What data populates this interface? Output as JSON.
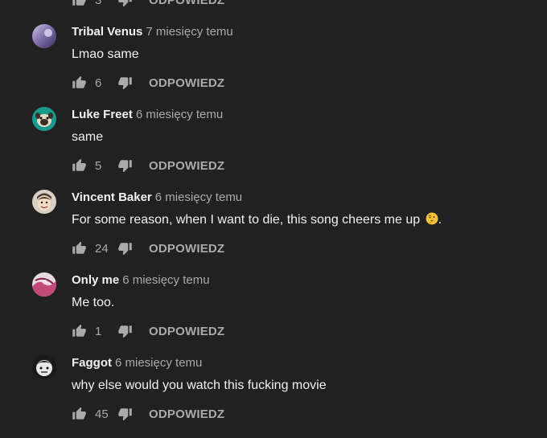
{
  "top_partial": {
    "likes": "3",
    "reply_label": "ODPOWIEDZ"
  },
  "comments": [
    {
      "author": "Tribal Venus",
      "time": "7 miesięcy temu",
      "text": "Lmao same",
      "likes": "6",
      "reply_label": "ODPOWIEDZ",
      "avatar_icon": "purple-gradient-avatar",
      "avatar_color": "#8b7fb0"
    },
    {
      "author": "Luke Freet",
      "time": "6 miesięcy temu",
      "text": "same",
      "likes": "5",
      "reply_label": "ODPOWIEDZ",
      "avatar_icon": "pug-avatar",
      "avatar_color": "#1a9a8a"
    },
    {
      "author": "Vincent Baker",
      "time": "6 miesięcy temu",
      "text": "For some reason, when I want to die, this song cheers me up",
      "text_suffix": ".",
      "emoji": "thinking-face-emoji",
      "likes": "24",
      "reply_label": "ODPOWIEDZ",
      "avatar_icon": "cartoon-face-avatar",
      "avatar_color": "#d8d0c4"
    },
    {
      "author": "Only me",
      "time": "6 miesięcy temu",
      "text": "Me too.",
      "likes": "1",
      "reply_label": "ODPOWIEDZ",
      "avatar_icon": "pink-avatar",
      "avatar_color": "#c24a7a"
    },
    {
      "author": "Faggot",
      "time": "6 miesięcy temu",
      "text": "why else would you watch this fucking movie",
      "likes": "45",
      "reply_label": "ODPOWIEDZ",
      "avatar_icon": "monochrome-avatar",
      "avatar_color": "#e8e8e8"
    }
  ],
  "colors": {
    "background": "#212121",
    "primary_text": "#f1f1f1",
    "secondary_text": "#aaaaaa"
  }
}
